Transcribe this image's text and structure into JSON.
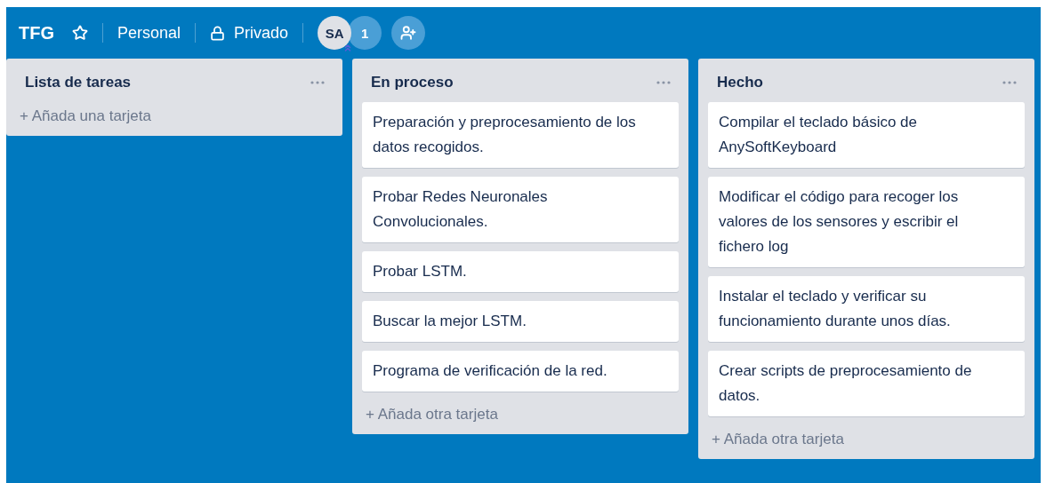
{
  "board": {
    "title": "TFG",
    "starred": false,
    "team": "Personal",
    "visibility": "Privado",
    "members": [
      {
        "initials": "SA",
        "admin": true
      }
    ],
    "member_count": "1"
  },
  "lists": [
    {
      "title": "Lista de tareas",
      "add_label": "+ Añada una tarjeta"
    },
    {
      "title": "En proceso",
      "cards": [
        "Preparación y preprocesamiento de los datos recogidos.",
        "Probar Redes Neuronales Convolucionales.",
        "Probar LSTM.",
        "Buscar la mejor LSTM.",
        "Programa de verificación de la red."
      ],
      "add_label": "+ Añada otra tarjeta"
    },
    {
      "title": "Hecho",
      "cards": [
        "Compilar el teclado básico de AnySoftKeyboard",
        "Modificar el código para recoger los valores de los sensores y escribir el fichero log",
        "Instalar el teclado y verificar su funcionamiento durante unos días.",
        "Crear scripts de preprocesamiento de datos."
      ],
      "add_label": "+ Añada otra tarjeta"
    }
  ]
}
